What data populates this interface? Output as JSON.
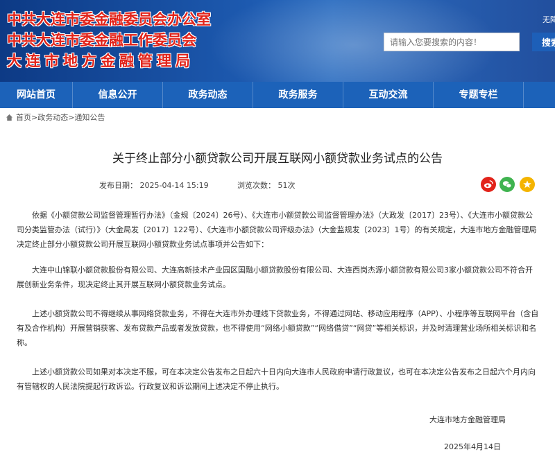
{
  "header": {
    "brand_line1": "中共大连市委金融委员会办公室",
    "brand_line2": "中共大连市委金融工作委员会",
    "brand_line3": "大连市地方金融管理局",
    "top_tip": "无障",
    "search_placeholder": "请输入您要搜索的内容！",
    "search_button": "搜索"
  },
  "nav": {
    "items": [
      {
        "label": "网站首页"
      },
      {
        "label": "信息公开"
      },
      {
        "label": "政务动态"
      },
      {
        "label": "政务服务"
      },
      {
        "label": "互动交流"
      },
      {
        "label": "专题专栏"
      }
    ]
  },
  "breadcrumb": {
    "text": "首页>政务动态>通知公告",
    "icon": "home-icon"
  },
  "article": {
    "title": "关于终止部分小额贷款公司开展互联网小额贷款业务试点的公告",
    "publish_date": "发布日期： 2025-04-14  15:19",
    "views": "浏览次数： 51次",
    "paragraphs": [
      "依据《小额贷款公司监督管理暂行办法》（金规〔2024〕26号）、《大连市小额贷款公司监督管理办法》（大政发〔2017〕23号）、《大连市小额贷款公司分类监管办法（试行）》（大金局发〔2017〕122号）、《大连市小额贷款公司评级办法》（大金监规发〔2023〕1号）的有关规定，大连市地方金融管理局决定终止部分小额贷款公司开展互联网小额贷款业务试点事项并公告如下：",
      "大连中山锦联小额贷款股份有限公司、大连高新技术产业园区国融小额贷款股份有限公司、大连西岗杰源小额贷款有限公司3家小额贷款公司不符合开展创新业务条件，现决定终止其开展互联网小额贷款业务试点。",
      "上述小额贷款公司不得继续从事网络贷款业务，不得在大连市外办理线下贷款业务，不得通过网站、移动应用程序（APP）、小程序等互联网平台（含自有及合作机构）开展营销获客、发布贷款产品或者发放贷款，也不得使用“网络小额贷款”“网络借贷”“网贷”等相关标识，并及时清理营业场所相关标识和名称。",
      "上述小额贷款公司如果对本决定不服，可在本决定公告发布之日起六十日内向大连市人民政府申请行政复议，也可在本决定公告发布之日起六个月内向有管辖权的人民法院提起行政诉讼。行政复议和诉讼期间上述决定不停止执行。"
    ],
    "signature": "大连市地方金融管理局",
    "sign_date": "2025年4月14日"
  },
  "share": [
    "weibo-icon",
    "wechat-icon",
    "qzone-icon"
  ],
  "colors": {
    "header_blue": "#1d5ab0",
    "nav_blue": "#1c62b9",
    "brand_red": "#e2231a"
  }
}
